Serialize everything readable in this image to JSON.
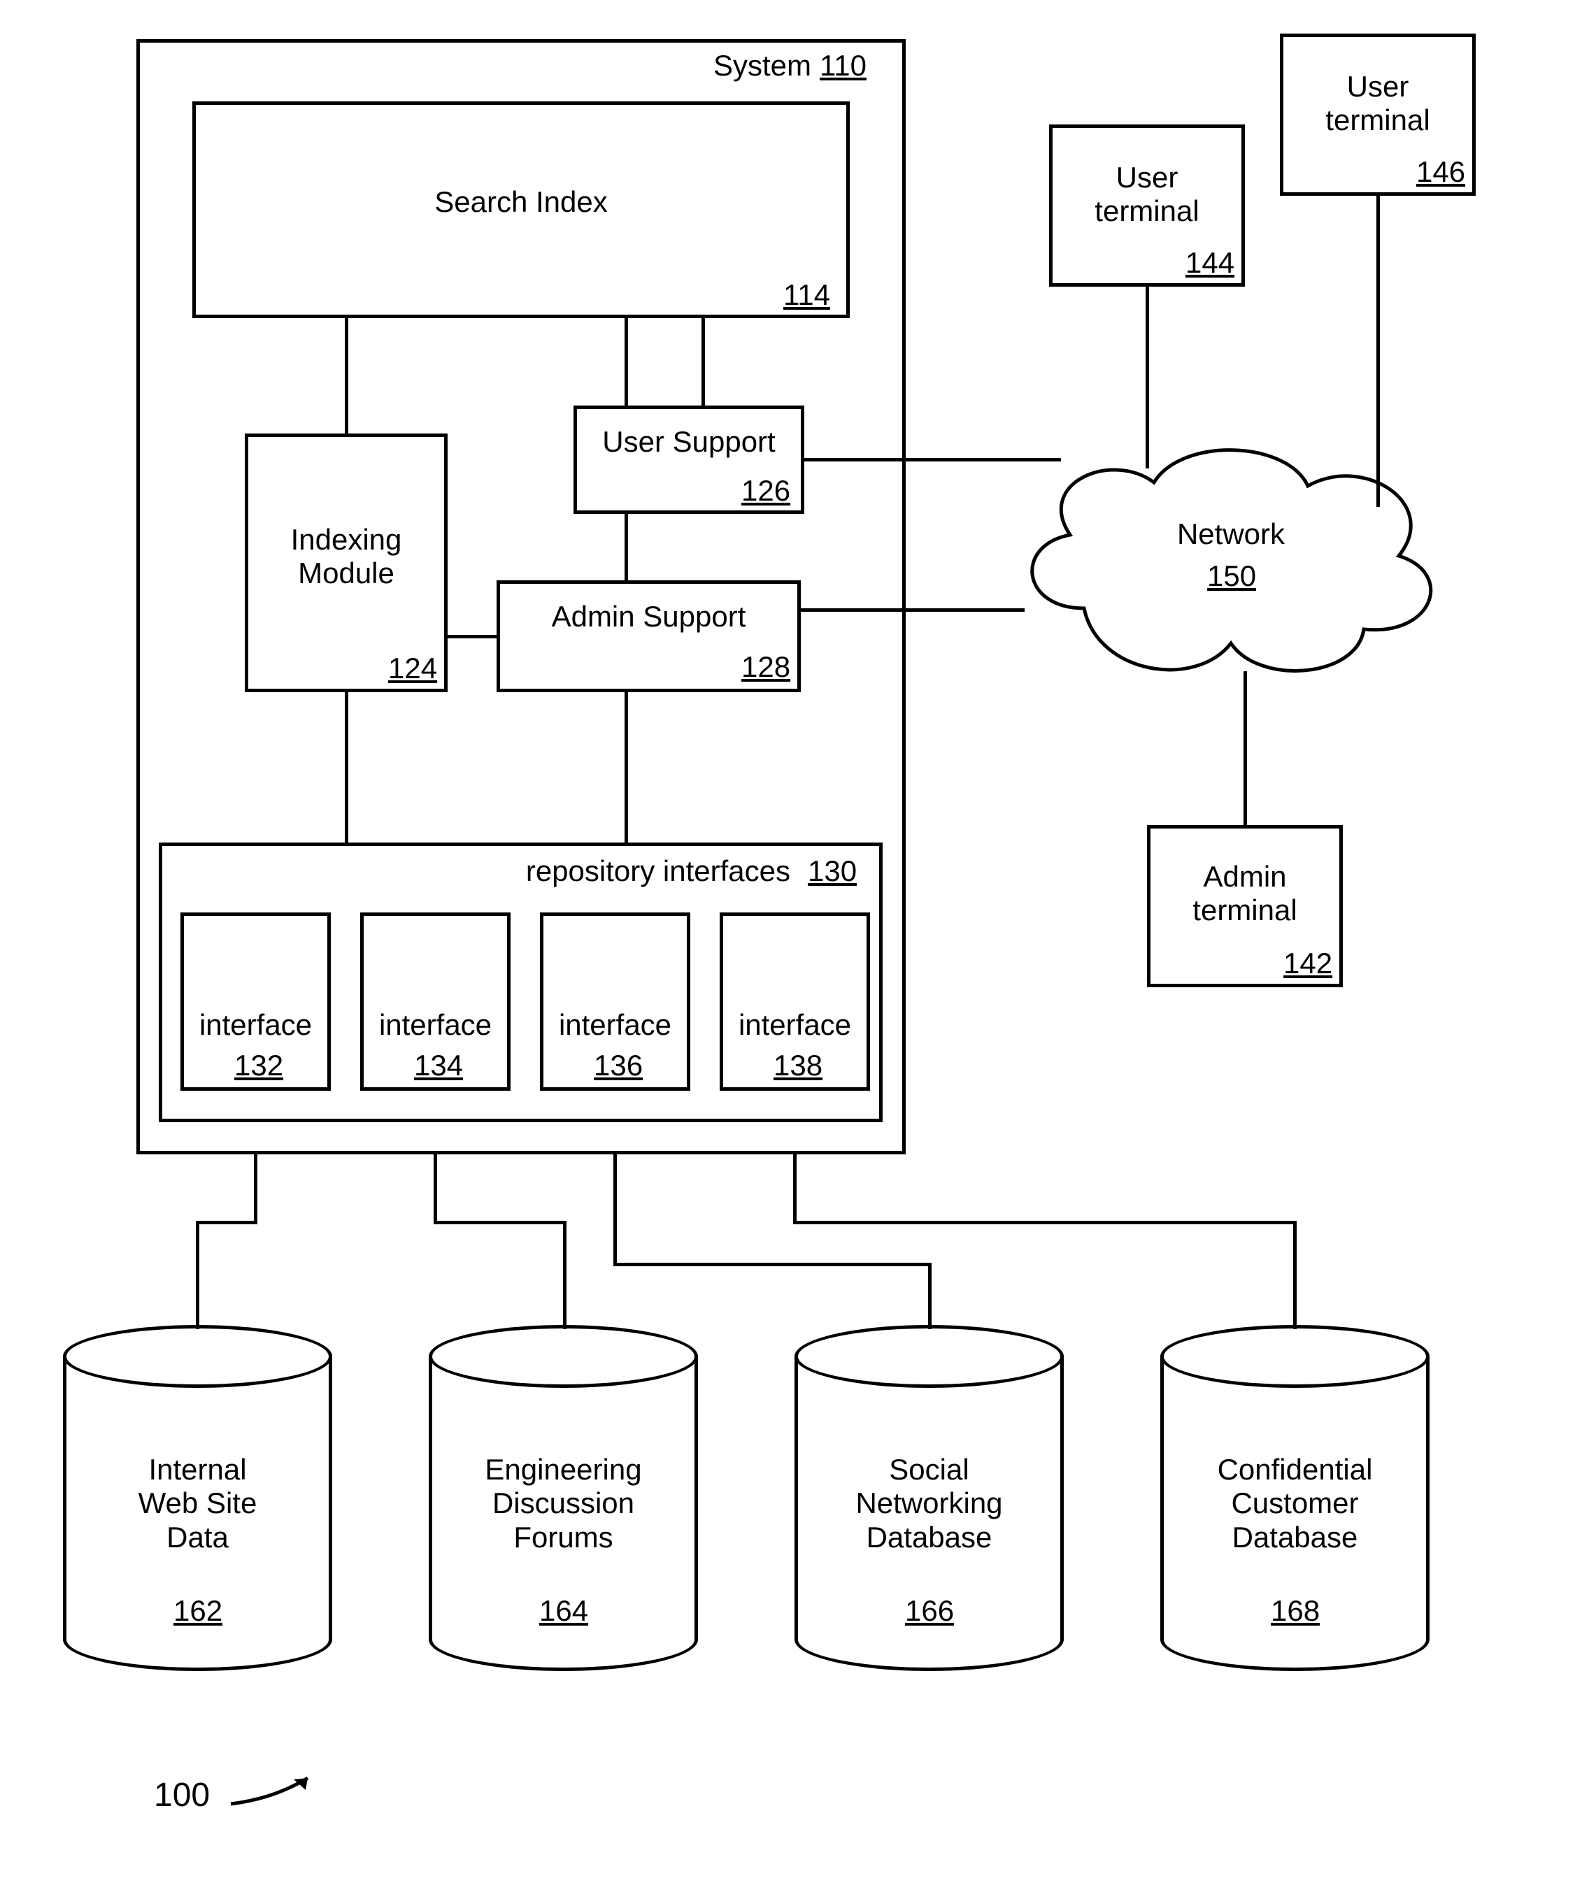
{
  "system": {
    "title": "System",
    "ref": "110"
  },
  "search_index": {
    "title": "Search Index",
    "ref": "114"
  },
  "indexing_module": {
    "title": "Indexing\nModule",
    "ref": "124"
  },
  "user_support": {
    "title": "User Support",
    "ref": "126"
  },
  "admin_support": {
    "title": "Admin Support",
    "ref": "128"
  },
  "repo_interfaces": {
    "title": "repository interfaces",
    "ref": "130"
  },
  "interfaces": [
    {
      "title": "interface",
      "ref": "132"
    },
    {
      "title": "interface",
      "ref": "134"
    },
    {
      "title": "interface",
      "ref": "136"
    },
    {
      "title": "interface",
      "ref": "138"
    }
  ],
  "user_terminal_144": {
    "title": "User\nterminal",
    "ref": "144"
  },
  "user_terminal_146": {
    "title": "User\nterminal",
    "ref": "146"
  },
  "network": {
    "title": "Network",
    "ref": "150"
  },
  "admin_terminal": {
    "title": "Admin\nterminal",
    "ref": "142"
  },
  "db_162": {
    "title": "Internal\nWeb Site\nData",
    "ref": "162"
  },
  "db_164": {
    "title": "Engineering\nDiscussion\nForums",
    "ref": "164"
  },
  "db_166": {
    "title": "Social\nNetworking\nDatabase",
    "ref": "166"
  },
  "db_168": {
    "title": "Confidential\nCustomer\nDatabase",
    "ref": "168"
  },
  "figure_ref": "100"
}
